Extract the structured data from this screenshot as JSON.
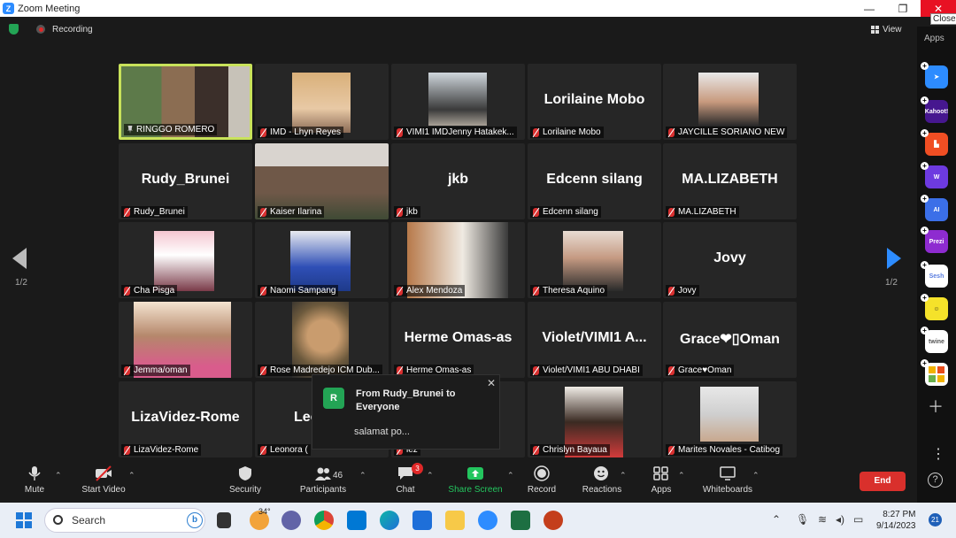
{
  "window": {
    "title": "Zoom Meeting",
    "close_tooltip": "Close"
  },
  "meeting": {
    "recording_label": "Recording",
    "view_label": "View"
  },
  "pagination": {
    "left": "1/2",
    "right": "1/2"
  },
  "tiles": [
    {
      "label": "RINGGO ROMERO",
      "big": ""
    },
    {
      "label": "IMD - Lhyn Reyes",
      "big": ""
    },
    {
      "label": "VIMI1 IMDJenny Hatakek...",
      "big": ""
    },
    {
      "label": "Lorilaine Mobo",
      "big": "Lorilaine Mobo"
    },
    {
      "label": "JAYCILLE SORIANO NEW",
      "big": ""
    },
    {
      "label": "Rudy_Brunei",
      "big": "Rudy_Brunei"
    },
    {
      "label": "Kaiser Ilarina",
      "big": ""
    },
    {
      "label": "jkb",
      "big": "jkb"
    },
    {
      "label": "Edcenn silang",
      "big": "Edcenn silang"
    },
    {
      "label": "MA.LIZABETH",
      "big": "MA.LIZABETH"
    },
    {
      "label": "Cha Pisga",
      "big": ""
    },
    {
      "label": "Naomi Sampang",
      "big": ""
    },
    {
      "label": "Alex Mendoza",
      "big": ""
    },
    {
      "label": "Theresa Aquino",
      "big": ""
    },
    {
      "label": "Jovy",
      "big": "Jovy"
    },
    {
      "label": "Jemma/oman",
      "big": ""
    },
    {
      "label": "Rose Madredejo ICM Dub...",
      "big": ""
    },
    {
      "label": "Herme Omas-as",
      "big": "Herme Omas-as"
    },
    {
      "label": "Violet/VIMI1 ABU DHABI",
      "big": "Violet/VIMI1  A..."
    },
    {
      "label": "Grace♥Oman",
      "big": "Grace❤▯Oman"
    },
    {
      "label": "LizaVidez-Rome",
      "big": "LizaVidez-Rome"
    },
    {
      "label": "Leonora (",
      "big": "Leonora"
    },
    {
      "label": "lez",
      "big": "y..."
    },
    {
      "label": "Chrislyn Bayaua",
      "big": ""
    },
    {
      "label": "Marites Novales - Catibog",
      "big": ""
    }
  ],
  "chat_popup": {
    "avatar_letter": "R",
    "from": "From Rudy_Brunei to Everyone",
    "message": "salamat po..."
  },
  "toolbar": {
    "mute": "Mute",
    "start_video": "Start Video",
    "security": "Security",
    "participants": "Participants",
    "participants_count": "46",
    "chat": "Chat",
    "chat_badge": "3",
    "share_screen": "Share Screen",
    "record": "Record",
    "reactions": "Reactions",
    "apps": "Apps",
    "whiteboards": "Whiteboards",
    "end": "End"
  },
  "apps_sidebar": {
    "title": "Apps",
    "apps": [
      {
        "name": "kahoot",
        "text": "Kahoot!",
        "color": "#46178f"
      },
      {
        "name": "prezi",
        "text": "Prezi",
        "color": "#8e2bd0"
      },
      {
        "name": "sesh",
        "text": "Sesh",
        "color": "#ffffff"
      },
      {
        "name": "twine",
        "text": "twine",
        "color": "#ffffff"
      }
    ]
  },
  "taskbar": {
    "search_placeholder": "Search",
    "temperature": "34°",
    "time": "8:27 PM",
    "date": "9/14/2023",
    "notifications": "21"
  },
  "colors": {
    "accent": "#2d8cff",
    "end": "#d9302c",
    "share": "#23c55e",
    "active_speaker": "#c8e25a"
  }
}
